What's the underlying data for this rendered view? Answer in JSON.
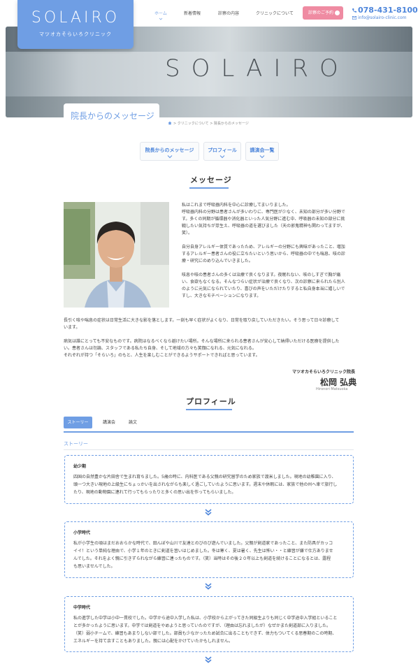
{
  "header": {
    "logo_text": "SOLAIRO",
    "logo_sub": "マツオカそらいろクリニック",
    "nav": [
      "ホーム",
      "新着情報",
      "診察の内容",
      "クリニックについて"
    ],
    "reserve_label": "診察のご予約",
    "phone": "078-431-8100",
    "mail": "info@solairo-clinic.com"
  },
  "hero": {
    "sign_text": "SOLAIRO"
  },
  "page": {
    "title": "院長からのメッセージ",
    "breadcrumb": "> クリニックについて > 院長からのメッセージ"
  },
  "subtabs": [
    "院長からのメッセージ",
    "プロフィール",
    "講演会一覧"
  ],
  "message": {
    "heading": "メッセージ",
    "right_paragraphs": [
      [
        "私はこれまで呼吸器内科を中心に診療してまいりました。",
        "呼吸器内科の分野は患者さんが多いわりに、専門医が少なく、未知の部分が多い分野で",
        "す。多くの同期が循環器や消化器といった人気分野に進む中、呼吸器の未知の部分に挑",
        "戦したい気持ちが芽生え、呼吸器の道を選びました（天の邪鬼精神も関わってますが、",
        "笑）。"
      ],
      [
        "自分自身アレルギー体質であったため、アレルギーの分野にも興味があったこと、増加",
        "するアレルギー患者さんの役に立ちたいという思いから、呼吸器の中でも喘息、咳の診",
        "療・研究にのめり込んでいきました。"
      ],
      [
        "咳息や咳の患者さんの多くは治療で良くなります。夜眠れない、咳のしすぎで胸が痛",
        "い、食欲もなくなる。そんなつらい症状が治療で良くなり、次の診察に来られたら別人",
        "のように元気になられていたり、喜びの声をいただけたりすると私自身本当に嬉しいで",
        "すし、大きなモチベーションになります。"
      ]
    ],
    "full_paragraphs": [
      [
        "長引く咳や喘息の症状は日常生活に大きな影を落とします。一刻も早く症状がよくなり、日常を取り戻していただきたい。そう思って日々診療して",
        "います。"
      ],
      [
        "病気は誰にとっても不安なものです。病院はなるべくなら避けたい場所。そんな場所に来られる患者さんが安心して納得いただける医療を提供した",
        "い。患者さんは勿論、スタッフである私たち自身、そして地域の方々も笑顔になれる、元気になれる。",
        "それぞれが持つ「そらいろ」のもと、人生を楽しむことができるようサポートできればと思っています。"
      ]
    ],
    "signature_org": "マツオカそらいろクリニック院長",
    "signature_name": "松岡 弘典",
    "signature_romaji": "Hironori Matsuoka"
  },
  "profile": {
    "heading": "プロフィール",
    "tabs": [
      "ストーリー",
      "講演会",
      "論文"
    ],
    "story_heading": "ストーリー",
    "cards": [
      {
        "title": "幼少期",
        "lines": [
          "四国の自然豊かな片田舎で生まれ育ちました。5歳の時に、内科医である父親の研究留学のため家族で渡米しました。現地の幼稚園に入り、",
          "頭一つ大きい現地の上級生にちょっかいを出されながらも楽しく過ごしていたように思います。週末や休暇には、家族で他の州へ車で旅行し",
          "たり、現地の動物園に連れて行ってもらったりと多くの思い出を作ってもらいました。"
        ]
      },
      {
        "title": "小学時代",
        "lines": [
          "私が小学生の頃はまだおおらかな時代で、田んぼや山川で友達とのびのび遊んでいました。父親が剣道家であったこと、また防具がカッコ",
          "イイ！という単純な理由で、小学１年のときに剣道を習いはじめました。冬は寒く、夏は暑く、先生は怖い・・と練習が嫌で仕方ありませ",
          "んでした。それをよく親に引きずられながら練習に連ったものです。（笑）当時はその後２０年以上も剣道を続けることになるとは、露程",
          "も思いませんでした。"
        ]
      },
      {
        "title": "中学時代",
        "lines": [
          "私の進学した中学は小中一貫校でした。中学から途中入学した私は、小学校から上がってきた同級生よりも同じく中学途中入学組といること",
          "とが多かったように思います。中学では剣道をやめようと思っていたのですが、（理由は忘れましたが）なぜかまた剣道部に入りました。",
          "（笑）弱小チームで、練習もあまりしない部でした。部員も少なかったため試合に出ることもできず、体力もついてくる思春期のこの時期、",
          "エネルギーを持て余すこともありました。親には心配をかけていたかもしれません。"
        ]
      }
    ]
  },
  "colors": {
    "accent": "#6f9ee4",
    "reserve": "#ef8ba2"
  }
}
